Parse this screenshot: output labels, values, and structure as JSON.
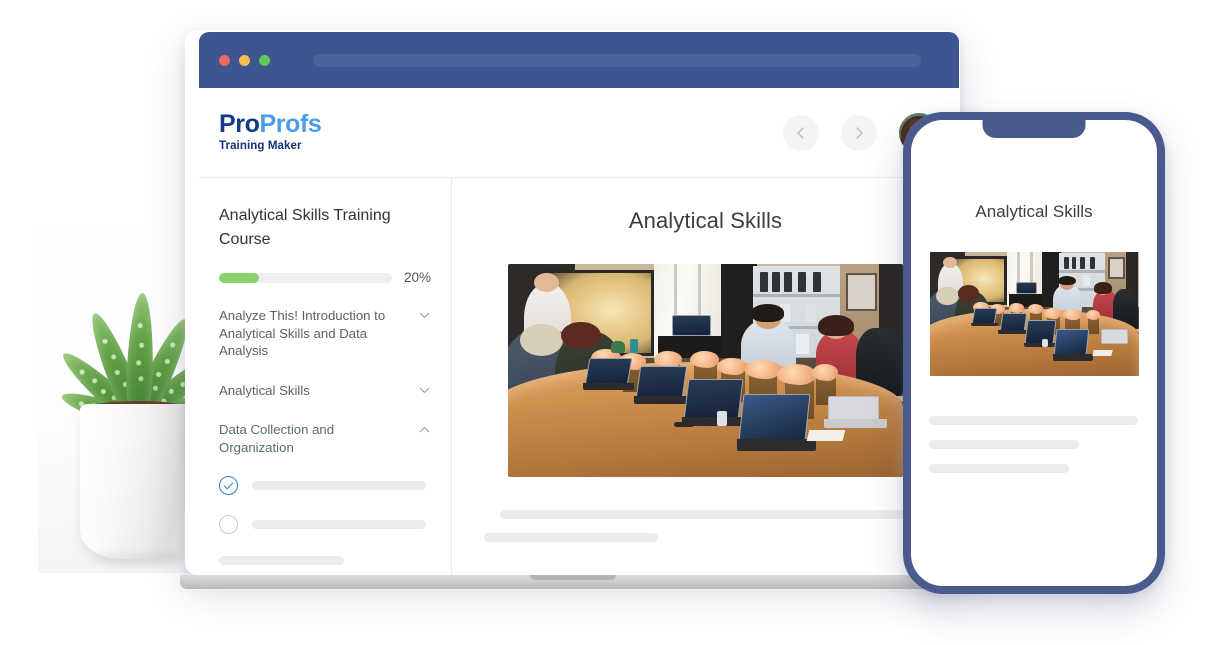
{
  "browser": {
    "traffic_lights": [
      "close-red",
      "minimize-yellow",
      "maximize-green"
    ],
    "chrome_color": "#3d5590",
    "urlbar_color": "#4d639b",
    "url_value": ""
  },
  "header": {
    "logo": {
      "pro": "Pro",
      "profs": "Profs",
      "tagline": "Training Maker",
      "pro_color": "#123a87",
      "profs_color": "#4a9ee8"
    },
    "back_label": "",
    "forward_label": "",
    "avatar_alt": "User profile photo"
  },
  "sidebar": {
    "course_title": "Analytical Skills Training Course",
    "progress": {
      "percent_label": "20%",
      "percent_value": 20,
      "fill_color": "#8bd26e",
      "track_color": "#efefef"
    },
    "modules": [
      {
        "label": "Analyze This! Introduction to Analytical Skills and Data Analysis",
        "expanded": false,
        "chevron": "chevron-down-icon"
      },
      {
        "label": "Analytical Skills",
        "expanded": false,
        "chevron": "chevron-down-icon"
      },
      {
        "label": "Data Collection and Organization",
        "expanded": true,
        "chevron": "chevron-up-icon"
      }
    ],
    "lessons": [
      {
        "status": "completed",
        "icon": "check-circle-icon",
        "title_placeholder": ""
      },
      {
        "status": "incomplete",
        "icon": "empty-circle-icon",
        "title_placeholder": ""
      }
    ],
    "placeholder_rows": 2
  },
  "main": {
    "title": "Analytical Skills",
    "image_alt": "Training session in a conference room with presenter and attendees at a boardroom table with laptops",
    "placeholder_rows": 2
  },
  "phone": {
    "title": "Analytical Skills",
    "image_alt": "Training session in a conference room with presenter and attendees at a boardroom table with laptops",
    "placeholder_rows": 3,
    "frame_color": "#4a5a8c"
  },
  "plant": {
    "alt": "Potted aloe plant in a white ceramic pot"
  }
}
